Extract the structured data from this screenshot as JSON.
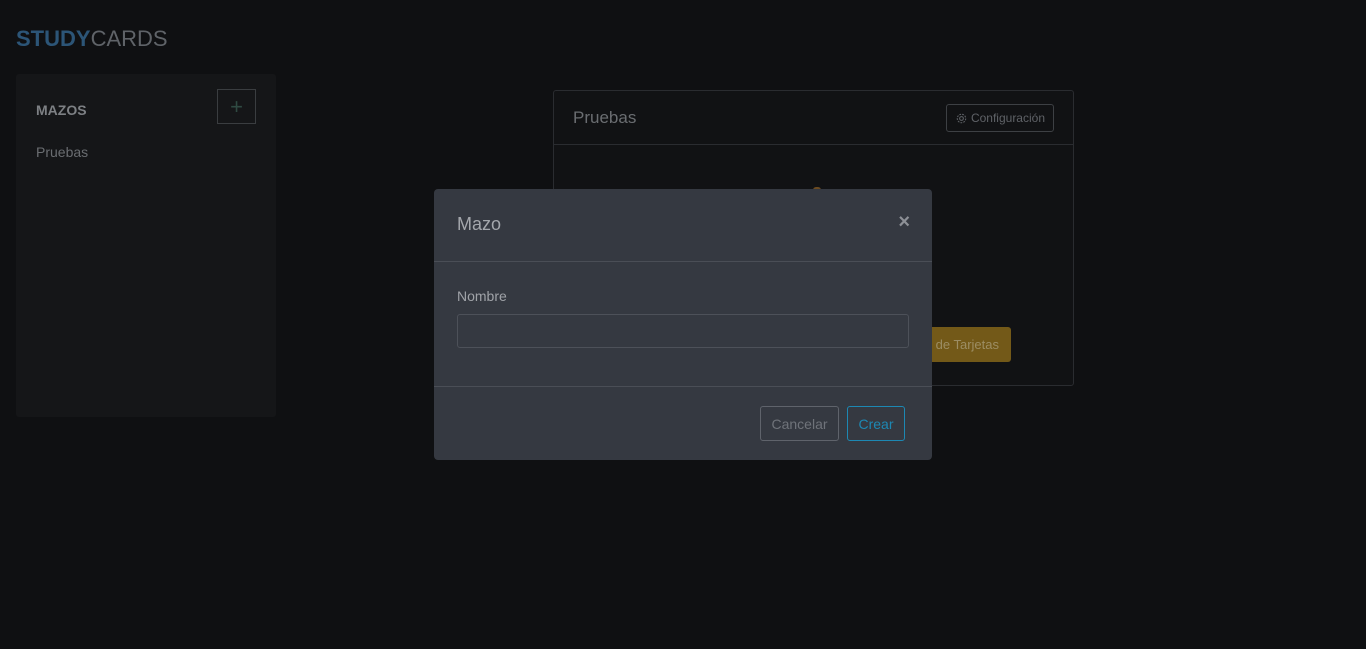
{
  "brand": {
    "bold": "STUDY",
    "light": "CARDS"
  },
  "sidebar": {
    "title": "MAZOS",
    "add_icon": "plus-icon",
    "items": [
      {
        "label": "Pruebas"
      }
    ]
  },
  "deck_card": {
    "title": "Pruebas",
    "config_label": "Configuración",
    "config_icon": "gear-icon",
    "action_label_visible": "de Tarjetas"
  },
  "modal": {
    "title": "Mazo",
    "close_label": "×",
    "field_label": "Nombre",
    "field_value": "",
    "field_placeholder": "",
    "cancel_label": "Cancelar",
    "create_label": "Crear"
  },
  "colors": {
    "accent": "#1d88b3",
    "warning": "#735918",
    "brand": "#2c5577"
  }
}
